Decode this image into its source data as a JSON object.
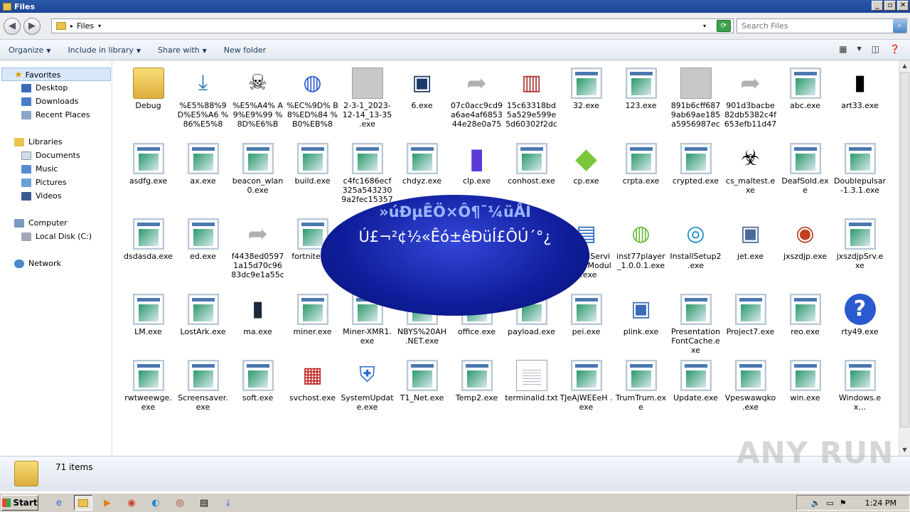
{
  "window": {
    "title": "Files",
    "minimize_label": "_",
    "maximize_label": "▫",
    "close_label": "✕"
  },
  "address": {
    "crumb": "Files",
    "back_label": "◀",
    "forward_label": "▶",
    "refresh_label": "⟳",
    "search_placeholder": "Search Files",
    "search_icon": "search-icon"
  },
  "toolbar": {
    "organize": "Organize",
    "include": "Include in library",
    "share": "Share with",
    "new_folder": "New folder"
  },
  "nav": {
    "favorites": "Favorites",
    "desktop": "Desktop",
    "downloads": "Downloads",
    "recent": "Recent Places",
    "libraries": "Libraries",
    "documents": "Documents",
    "music": "Music",
    "pictures": "Pictures",
    "videos": "Videos",
    "computer": "Computer",
    "local_disk": "Local Disk (C:)",
    "network": "Network"
  },
  "files": [
    {
      "label": "Debug",
      "icon": "folder"
    },
    {
      "label": "%E5%88%9 D%E5%A6 %86%E5%8 A%A9%E…",
      "icon": "download"
    },
    {
      "label": "%E5%A4% A9%E9%99 %8D%E6%B F%80%E5…",
      "icon": "skull-gear"
    },
    {
      "label": "%EC%9D% B8%ED%84 %B0%EB%8 4%B7_%E…",
      "icon": "globe"
    },
    {
      "label": "2-3-1_2023- 12-14_13-35 .exe",
      "icon": "grey"
    },
    {
      "label": "6.exe",
      "icon": "monitor"
    },
    {
      "label": "07c0acc9cd9 a6ae4af6853 44e28e0a75 6d3f3a77a…",
      "icon": "shortcut"
    },
    {
      "label": "15c63318bd 5a529e599e 5d60302f2dc 14961ebcc…",
      "icon": "winrar"
    },
    {
      "label": "32.exe",
      "icon": "exe"
    },
    {
      "label": "123.exe",
      "icon": "exe"
    },
    {
      "label": "891b6cff687 9ab69ae185 a5956987ec 46daaf434…",
      "icon": "grey"
    },
    {
      "label": "901d3bacbe 82db5382c4f 653efb11d47 84254b3a…",
      "icon": "shortcut"
    },
    {
      "label": "abc.exe",
      "icon": "exe"
    },
    {
      "label": "art33.exe",
      "icon": "barcode"
    },
    {
      "label": "asdfg.exe",
      "icon": "exe"
    },
    {
      "label": "ax.exe",
      "icon": "exe"
    },
    {
      "label": "beacon_wlan 0.exe",
      "icon": "exe"
    },
    {
      "label": "build.exe",
      "icon": "exe"
    },
    {
      "label": "c4fc1686ecf 325a543230 9a2fec15357 f6ff84…",
      "icon": "exe"
    },
    {
      "label": "chdyz.exe",
      "icon": "exe"
    },
    {
      "label": "clp.exe",
      "icon": "gradient"
    },
    {
      "label": "conhost.exe",
      "icon": "exe"
    },
    {
      "label": "cp.exe",
      "icon": "cube"
    },
    {
      "label": "crpta.exe",
      "icon": "exe"
    },
    {
      "label": "crypted.exe",
      "icon": "exe"
    },
    {
      "label": "cs_maltest.e xe",
      "icon": "biohazard"
    },
    {
      "label": "DeafSold.ex e",
      "icon": "exe"
    },
    {
      "label": "Doublepulsar -1.3.1.exe",
      "icon": "exe"
    },
    {
      "label": "dsdasda.exe",
      "icon": "exe"
    },
    {
      "label": "ed.exe",
      "icon": "exe"
    },
    {
      "label": "f4438ed0597 1a15d70c96 83dc9e1a55c 583ea8c6…",
      "icon": "shortcut"
    },
    {
      "label": "fortnite3…",
      "icon": "exe"
    },
    {
      "label": "",
      "icon": "none"
    },
    {
      "label": "",
      "icon": "none"
    },
    {
      "label": "",
      "icon": "none"
    },
    {
      "label": "…exe",
      "icon": "redcam"
    },
    {
      "label": "igfxCUIServi ce%20Modul e.exe",
      "icon": "window"
    },
    {
      "label": "inst77player _1.0.0.1.exe",
      "icon": "naas"
    },
    {
      "label": "InstallSetup2 .exe",
      "icon": "wifi"
    },
    {
      "label": "jet.exe",
      "icon": "jet"
    },
    {
      "label": "jxszdjp.exe",
      "icon": "disc"
    },
    {
      "label": "jxszdjpSrv.e xe",
      "icon": "exe"
    },
    {
      "label": "LM.exe",
      "icon": "exe"
    },
    {
      "label": "LostArk.exe",
      "icon": "exe"
    },
    {
      "label": "ma.exe",
      "icon": "blackbox"
    },
    {
      "label": "miner.exe",
      "icon": "exe"
    },
    {
      "label": "Miner-XMR1. exe",
      "icon": "exe"
    },
    {
      "label": "NBYS%20AH .NET.exe",
      "icon": "exe"
    },
    {
      "label": "office.exe",
      "icon": "exe"
    },
    {
      "label": "payload.exe",
      "icon": "exe"
    },
    {
      "label": "pei.exe",
      "icon": "exe"
    },
    {
      "label": "plink.exe",
      "icon": "network-pc"
    },
    {
      "label": "Presentation FontCache.e xe",
      "icon": "exe"
    },
    {
      "label": "Project7.exe",
      "icon": "exe"
    },
    {
      "label": "reo.exe",
      "icon": "exe"
    },
    {
      "label": "rty49.exe",
      "icon": "help"
    },
    {
      "label": "rwtweewge. exe",
      "icon": "exe"
    },
    {
      "label": "Screensaver. exe",
      "icon": "exe"
    },
    {
      "label": "soft.exe",
      "icon": "exe"
    },
    {
      "label": "svchost.exe",
      "icon": "doc"
    },
    {
      "label": "SystemUpdat e.exe",
      "icon": "shield-exe"
    },
    {
      "label": "T1_Net.exe",
      "icon": "exe"
    },
    {
      "label": "Temp2.exe",
      "icon": "exe"
    },
    {
      "label": "terminalid.txt",
      "icon": "txt"
    },
    {
      "label": "TJeAjWEEeH .exe",
      "icon": "exe"
    },
    {
      "label": "TrumTrum.ex e",
      "icon": "exe"
    },
    {
      "label": "Update.exe",
      "icon": "exe"
    },
    {
      "label": "Vpeswawqko .exe",
      "icon": "exe"
    },
    {
      "label": "win.exe",
      "icon": "exe"
    },
    {
      "label": "Windows.ex…",
      "icon": "exe"
    }
  ],
  "popup": {
    "line1": "»úÐµÊÖ×Ô¶¯¼üÅÌ",
    "line2": "Ú£¬²¢½«Êó±êÐüÍ£ÔÚ´°¿"
  },
  "status": {
    "count": "71 items"
  },
  "watermark": "ANY RUN",
  "taskbar": {
    "start": "Start",
    "time": "1:24 PM"
  }
}
